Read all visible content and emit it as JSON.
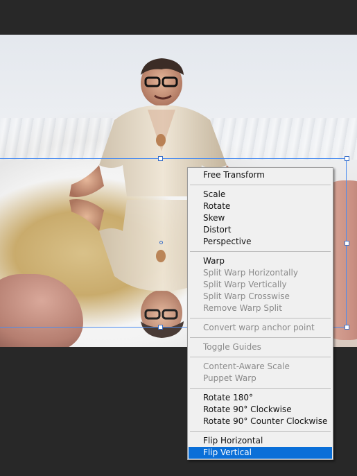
{
  "menu": {
    "items": [
      {
        "label": "Free Transform",
        "enabled": true
      },
      {
        "label": "Scale",
        "enabled": true
      },
      {
        "label": "Rotate",
        "enabled": true
      },
      {
        "label": "Skew",
        "enabled": true
      },
      {
        "label": "Distort",
        "enabled": true
      },
      {
        "label": "Perspective",
        "enabled": true
      },
      {
        "label": "Warp",
        "enabled": true
      },
      {
        "label": "Split Warp Horizontally",
        "enabled": false
      },
      {
        "label": "Split Warp Vertically",
        "enabled": false
      },
      {
        "label": "Split Warp Crosswise",
        "enabled": false
      },
      {
        "label": "Remove Warp Split",
        "enabled": false
      },
      {
        "label": "Convert warp anchor point",
        "enabled": false
      },
      {
        "label": "Toggle Guides",
        "enabled": false
      },
      {
        "label": "Content-Aware Scale",
        "enabled": false
      },
      {
        "label": "Puppet Warp",
        "enabled": false
      },
      {
        "label": "Rotate 180°",
        "enabled": true
      },
      {
        "label": "Rotate 90° Clockwise",
        "enabled": true
      },
      {
        "label": "Rotate 90° Counter Clockwise",
        "enabled": true
      },
      {
        "label": "Flip Horizontal",
        "enabled": true
      },
      {
        "label": "Flip Vertical",
        "enabled": true,
        "selected": true
      }
    ]
  },
  "colors": {
    "app_background": "#282828",
    "menu_background": "#f0f0f0",
    "selection": "#0a6fd8",
    "bounding_box": "#4a8cf0"
  }
}
